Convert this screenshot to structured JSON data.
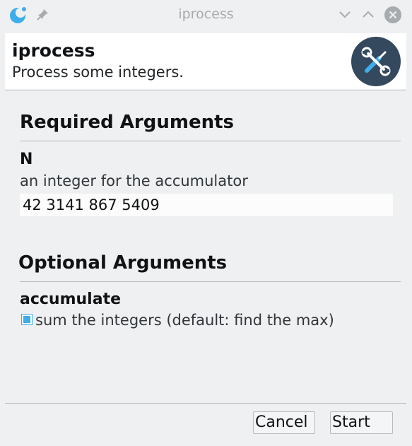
{
  "window": {
    "title": "iprocess"
  },
  "header": {
    "title": "iprocess",
    "description": "Process some integers."
  },
  "required": {
    "section_title": "Required Arguments",
    "arg_name": "N",
    "arg_help": "an integer for the accumulator",
    "arg_value": "42 3141 867 5409"
  },
  "optional": {
    "section_title": "Optional Arguments",
    "arg_name": "accumulate",
    "checkbox_label": "sum the integers (default: find the max)",
    "checked": true
  },
  "footer": {
    "cancel_label": "Cancel",
    "start_label": "Start"
  },
  "colors": {
    "accent": "#3daee9",
    "header_icon_bg": "#34495e",
    "background": "#eff0f1"
  }
}
